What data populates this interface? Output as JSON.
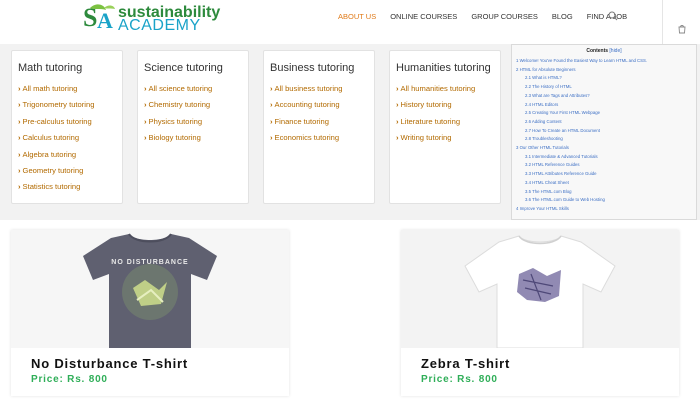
{
  "header": {
    "logo_line1": "sustainability",
    "logo_line2": "ACADEMY",
    "nav": [
      {
        "label": "ABOUT US",
        "active": true
      },
      {
        "label": "ONLINE COURSES",
        "active": false
      },
      {
        "label": "GROUP COURSES",
        "active": false
      },
      {
        "label": "BLOG",
        "active": false
      },
      {
        "label": "FIND A JOB",
        "active": false
      }
    ],
    "icons": {
      "search": "search-icon",
      "cart": "cart-icon"
    }
  },
  "categories": [
    {
      "title": "Math tutoring",
      "links": [
        "All math tutoring",
        "Trigonometry tutoring",
        "Pre-calculus tutoring",
        "Calculus tutoring",
        "Algebra tutoring",
        "Geometry tutoring",
        "Statistics tutoring"
      ]
    },
    {
      "title": "Science tutoring",
      "links": [
        "All science tutoring",
        "Chemistry tutoring",
        "Physics tutoring",
        "Biology tutoring"
      ]
    },
    {
      "title": "Business tutoring",
      "links": [
        "All business tutoring",
        "Accounting tutoring",
        "Finance tutoring",
        "Economics tutoring"
      ]
    },
    {
      "title": "Humanities tutoring",
      "links": [
        "All humanities tutoring",
        "History tutoring",
        "Literature tutoring",
        "Writing tutoring"
      ]
    }
  ],
  "toc": {
    "heading": "Contents",
    "hide_label": "[hide]",
    "items": [
      {
        "text": "1 Welcome! You've Found the Easiest Way to Learn HTML and CSS.",
        "level": 1
      },
      {
        "text": "2 HTML for Absolute Beginners",
        "level": 1
      },
      {
        "text": "2.1 What is HTML?",
        "level": 2
      },
      {
        "text": "2.2 The History of HTML",
        "level": 2
      },
      {
        "text": "2.3 What are Tags and Attributes?",
        "level": 2
      },
      {
        "text": "2.4 HTML Editors",
        "level": 2
      },
      {
        "text": "2.5 Creating Your First HTML Webpage",
        "level": 2
      },
      {
        "text": "2.6 Adding Content",
        "level": 2
      },
      {
        "text": "2.7 How To Create an HTML Document",
        "level": 2
      },
      {
        "text": "2.8 Troubleshooting",
        "level": 2
      },
      {
        "text": "3 Our Other HTML Tutorials",
        "level": 1
      },
      {
        "text": "3.1 Intermediate & Advanced Tutorials",
        "level": 2
      },
      {
        "text": "3.2 HTML Reference Guides",
        "level": 2
      },
      {
        "text": "3.3 HTML Attributes Reference Guide",
        "level": 2
      },
      {
        "text": "3.4 HTML Cheat Sheet",
        "level": 2
      },
      {
        "text": "3.5 The HTML.com Blog",
        "level": 2
      },
      {
        "text": "3.6 The HTML.com Guide to Web Hosting",
        "level": 2
      },
      {
        "text": "4 Improve Your HTML Skills",
        "level": 1
      }
    ]
  },
  "products": [
    {
      "name": "No Disturbance T-shirt",
      "price": "Price: Rs. 800",
      "print_text": "NO DISTURBANCE",
      "shirt_color": "#5f6070"
    },
    {
      "name": "Zebra T-shirt",
      "price": "Price: Rs. 800",
      "print_text": "",
      "shirt_color": "#ffffff"
    }
  ],
  "colors": {
    "accent_nav": "#e07b1a",
    "link": "#b26a00",
    "price": "#2fae58",
    "toc_link": "#3b6ec4"
  }
}
